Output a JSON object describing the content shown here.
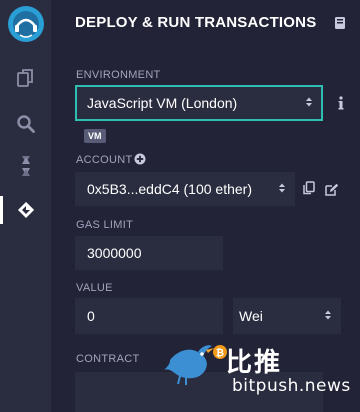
{
  "panel": {
    "title": "DEPLOY & RUN TRANSACTIONS"
  },
  "sidebar": {
    "items": [
      {
        "name": "home",
        "icon": "remix-logo-icon"
      },
      {
        "name": "file-explorer",
        "icon": "files-icon"
      },
      {
        "name": "search",
        "icon": "search-icon"
      },
      {
        "name": "compiler",
        "icon": "solidity-compiler-icon"
      },
      {
        "name": "deploy-run",
        "icon": "deploy-run-icon",
        "active": true
      }
    ]
  },
  "environment": {
    "label": "ENVIRONMENT",
    "value": "JavaScript VM (London)",
    "badge": "VM"
  },
  "account": {
    "label": "ACCOUNT",
    "value": "0x5B3...eddC4 (100 ether)"
  },
  "gas_limit": {
    "label": "GAS LIMIT",
    "value": "3000000"
  },
  "value": {
    "label": "VALUE",
    "amount": "0",
    "unit": "Wei"
  },
  "contract": {
    "label": "CONTRACT"
  },
  "watermark": {
    "cn": "比推",
    "en": "bitpush.news"
  },
  "colors": {
    "background": "#222336",
    "sidebar": "#2a2c3f",
    "field": "#2a2c3f",
    "accent": "#2fbfb1",
    "logo": "#2a9fd6"
  }
}
